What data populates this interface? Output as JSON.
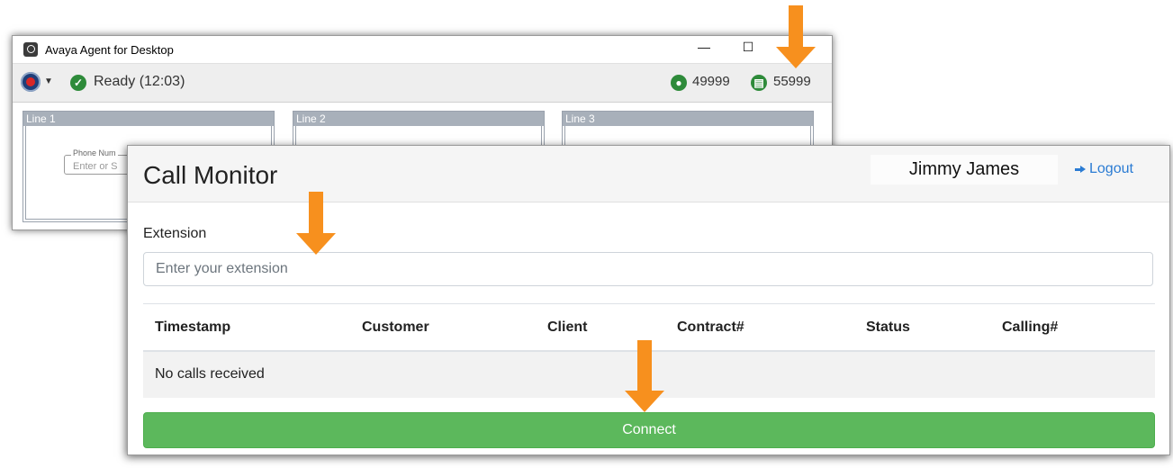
{
  "avaya": {
    "title": "Avaya Agent for Desktop",
    "minimize": "—",
    "maximize": "☐",
    "status": "Ready (12:03)",
    "agent_id": "49999",
    "extension": "55999",
    "lines": [
      {
        "label": "Line 1",
        "phone_label": "Phone Num",
        "phone_placeholder": "Enter or S"
      },
      {
        "label": "Line 2"
      },
      {
        "label": "Line 3"
      }
    ]
  },
  "call_monitor": {
    "title": "Call Monitor",
    "user": "Jimmy James",
    "logout": "Logout",
    "extension_label": "Extension",
    "extension_placeholder": "Enter your extension",
    "columns": [
      "Timestamp",
      "Customer",
      "Client",
      "Contract#",
      "Status",
      "Calling#"
    ],
    "empty_message": "No calls received",
    "connect": "Connect"
  },
  "colors": {
    "arrow": "#f7901e",
    "connect": "#5cb85c",
    "ready": "#2e8b3a",
    "link": "#2a7bd3"
  }
}
